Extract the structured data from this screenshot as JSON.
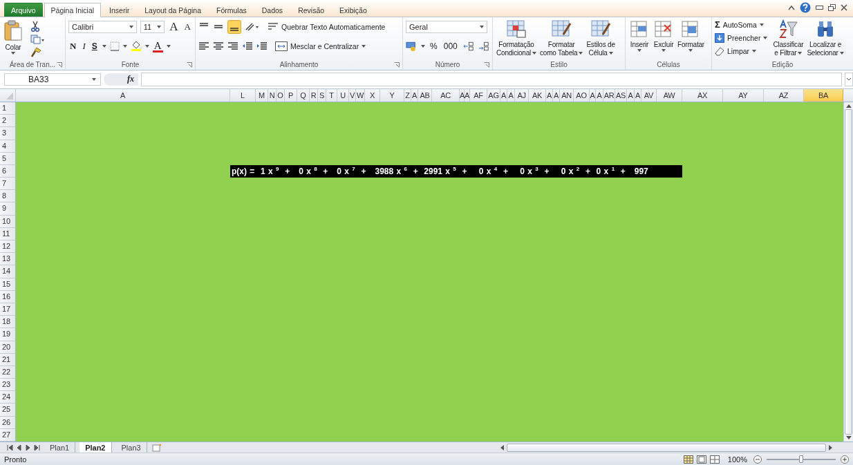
{
  "ribbon_tabs": [
    {
      "label": "Arquivo",
      "kind": "file"
    },
    {
      "label": "Página Inicial",
      "kind": "tab",
      "selected": true
    },
    {
      "label": "Inserir",
      "kind": "tab",
      "selected": false
    },
    {
      "label": "Layout da Página",
      "kind": "tab",
      "selected": false
    },
    {
      "label": "Fórmulas",
      "kind": "tab",
      "selected": false
    },
    {
      "label": "Dados",
      "kind": "tab",
      "selected": false
    },
    {
      "label": "Revisão",
      "kind": "tab",
      "selected": false
    },
    {
      "label": "Exibição",
      "kind": "tab",
      "selected": false
    }
  ],
  "clipboard": {
    "paste": "Colar",
    "label": "Área de Tran..."
  },
  "font": {
    "name": "Calibri",
    "size": "11",
    "grow": "A",
    "shrink": "A",
    "bold": "N",
    "italic": "I",
    "underline": "S",
    "color_letter": "A",
    "label": "Fonte"
  },
  "alignment": {
    "wrap": "Quebrar Texto Automaticamente",
    "merge": "Mesclar e Centralizar",
    "label": "Alinhamento"
  },
  "number": {
    "format": "Geral",
    "percent": "%",
    "thousands": "000",
    "label": "Número"
  },
  "styles": {
    "buttons": [
      {
        "line1": "Formatação",
        "line2": "Condicional"
      },
      {
        "line1": "Formatar",
        "line2": "como Tabela"
      },
      {
        "line1": "Estilos de",
        "line2": "Célula"
      }
    ],
    "label": "Estilo"
  },
  "cells": {
    "buttons": [
      "Inserir",
      "Excluir",
      "Formatar"
    ],
    "label": "Células"
  },
  "editing": {
    "sigma": "Σ",
    "autosum": "AutoSoma",
    "fill": "Preencher",
    "clear": "Limpar",
    "sort": {
      "line1": "Classificar",
      "line2": "e Filtrar"
    },
    "find": {
      "line1": "Localizar e",
      "line2": "Selecionar"
    },
    "label": "Edição"
  },
  "formula_bar": {
    "name_box": "BA33",
    "fx": "fx"
  },
  "columns": [
    {
      "label": "A",
      "selected": false
    },
    {
      "label": "L",
      "selected": false
    },
    {
      "label": "M",
      "selected": false
    },
    {
      "label": "N",
      "selected": false
    },
    {
      "label": "O",
      "selected": false
    },
    {
      "label": "P",
      "selected": false
    },
    {
      "label": "Q",
      "selected": false
    },
    {
      "label": "R",
      "selected": false
    },
    {
      "label": "S",
      "selected": false
    },
    {
      "label": "T",
      "selected": false
    },
    {
      "label": "U",
      "selected": false
    },
    {
      "label": "V",
      "selected": false
    },
    {
      "label": "W",
      "selected": false
    },
    {
      "label": "X",
      "selected": false
    },
    {
      "label": "Y",
      "selected": false
    },
    {
      "label": "Z",
      "selected": false
    },
    {
      "label": "A",
      "selected": false
    },
    {
      "label": "AB",
      "selected": false
    },
    {
      "label": "AC",
      "selected": false
    },
    {
      "label": "A",
      "selected": false
    },
    {
      "label": "A",
      "selected": false
    },
    {
      "label": "AF",
      "selected": false
    },
    {
      "label": "AG",
      "selected": false
    },
    {
      "label": "A",
      "selected": false
    },
    {
      "label": "A",
      "selected": false
    },
    {
      "label": "AJ",
      "selected": false
    },
    {
      "label": "AK",
      "selected": false
    },
    {
      "label": "A",
      "selected": false
    },
    {
      "label": "A",
      "selected": false
    },
    {
      "label": "AN",
      "selected": false
    },
    {
      "label": "AO",
      "selected": false
    },
    {
      "label": "A",
      "selected": false
    },
    {
      "label": "A",
      "selected": false
    },
    {
      "label": "AR",
      "selected": false
    },
    {
      "label": "AS",
      "selected": false
    },
    {
      "label": "A",
      "selected": false
    },
    {
      "label": "A",
      "selected": false
    },
    {
      "label": "AV",
      "selected": false
    },
    {
      "label": "AW",
      "selected": false
    },
    {
      "label": "AX",
      "selected": false
    },
    {
      "label": "AY",
      "selected": false
    },
    {
      "label": "AZ",
      "selected": false
    },
    {
      "label": "BA",
      "selected": true
    }
  ],
  "rows": [
    {
      "label": "1"
    },
    {
      "label": "2"
    },
    {
      "label": "3"
    },
    {
      "label": "4"
    },
    {
      "label": "5"
    },
    {
      "label": "6",
      "banner": "p(x) =  1 x $^{9}$  +   0 x $^{8}$  +   0 x $^{7}$  +   3988 x $^{6}$  +  2991 x $^{5}$  +    0 x $^{4}$  +    0 x $^{3}$  +    0 x $^{2}$  +  0 x $^{1}$  +   997"
    },
    {
      "label": "7"
    },
    {
      "label": "8"
    },
    {
      "label": "9"
    },
    {
      "label": "10"
    },
    {
      "label": "11"
    },
    {
      "label": "12"
    },
    {
      "label": "13"
    },
    {
      "label": "14"
    },
    {
      "label": "15"
    },
    {
      "label": "16"
    },
    {
      "label": "17"
    },
    {
      "label": "18"
    },
    {
      "label": "19"
    },
    {
      "label": "20"
    },
    {
      "label": "21"
    },
    {
      "label": "22"
    },
    {
      "label": "23"
    },
    {
      "label": "24"
    },
    {
      "label": "25"
    },
    {
      "label": "26"
    },
    {
      "label": "27"
    }
  ],
  "sheet_tabs": [
    {
      "label": "Plan1",
      "selected": false
    },
    {
      "label": "Plan2",
      "selected": true
    },
    {
      "label": "Plan3",
      "selected": false
    }
  ],
  "status": {
    "text": "Pronto",
    "zoom": "100%",
    "zoom_slider": {
      "level": 0.5
    },
    "views": [
      {
        "selected": true
      },
      {
        "selected": false
      },
      {
        "selected": false
      }
    ]
  }
}
